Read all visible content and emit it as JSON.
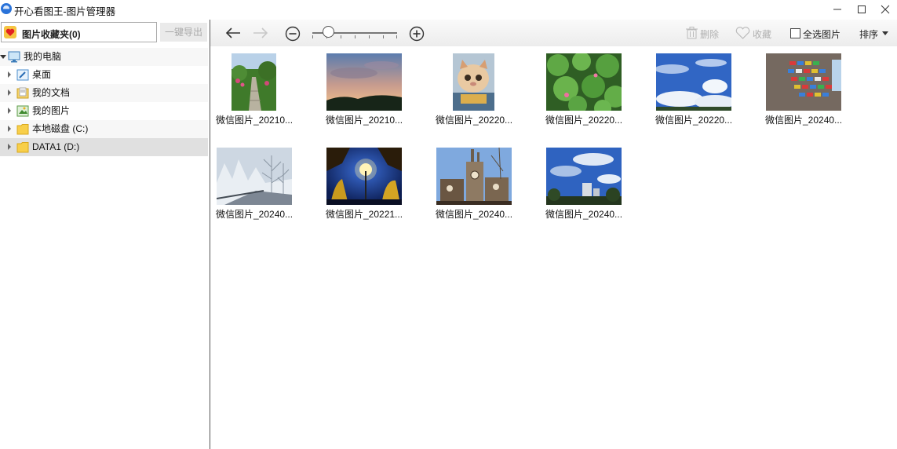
{
  "window": {
    "title": "开心看图王-图片管理器",
    "controls": [
      "minimize-icon",
      "maximize-icon",
      "close-icon"
    ]
  },
  "sidebar": {
    "favorites_label": "图片收藏夹(0)",
    "export_button": "一键导出",
    "tree": [
      {
        "label": "我的电脑",
        "icon": "computer-icon",
        "expanded": true
      },
      {
        "label": "桌面",
        "icon": "desktop-icon"
      },
      {
        "label": "我的文档",
        "icon": "documents-icon"
      },
      {
        "label": "我的图片",
        "icon": "pictures-icon"
      },
      {
        "label": "本地磁盘 (C:)",
        "icon": "folder-icon"
      },
      {
        "label": "DATA1 (D:)",
        "icon": "folder-icon",
        "selected": true
      }
    ]
  },
  "toolbar": {
    "back": "back-arrow-icon",
    "forward": "forward-arrow-icon",
    "zoom_out": "zoom-out-icon",
    "zoom_in": "zoom-in-icon",
    "zoom_level": 0.2,
    "delete_label": "删除",
    "favorite_label": "收藏",
    "select_all_label": "全选图片",
    "sort_label": "排序"
  },
  "images": [
    {
      "caption": "微信图片_20210...",
      "scene": "garden path"
    },
    {
      "caption": "微信图片_20210...",
      "scene": "sunset sky"
    },
    {
      "caption": "微信图片_20220...",
      "scene": "cat"
    },
    {
      "caption": "微信图片_20220...",
      "scene": "lotus leaves"
    },
    {
      "caption": "微信图片_20220...",
      "scene": "blue sky clouds"
    },
    {
      "caption": "微信图片_20240...",
      "scene": "wall signs"
    },
    {
      "caption": "微信图片_20240...",
      "scene": "snowy trees"
    },
    {
      "caption": "微信图片_20221...",
      "scene": "night street lamp"
    },
    {
      "caption": "微信图片_20240...",
      "scene": "clock tower"
    },
    {
      "caption": "微信图片_20240...",
      "scene": "city sky"
    }
  ]
}
